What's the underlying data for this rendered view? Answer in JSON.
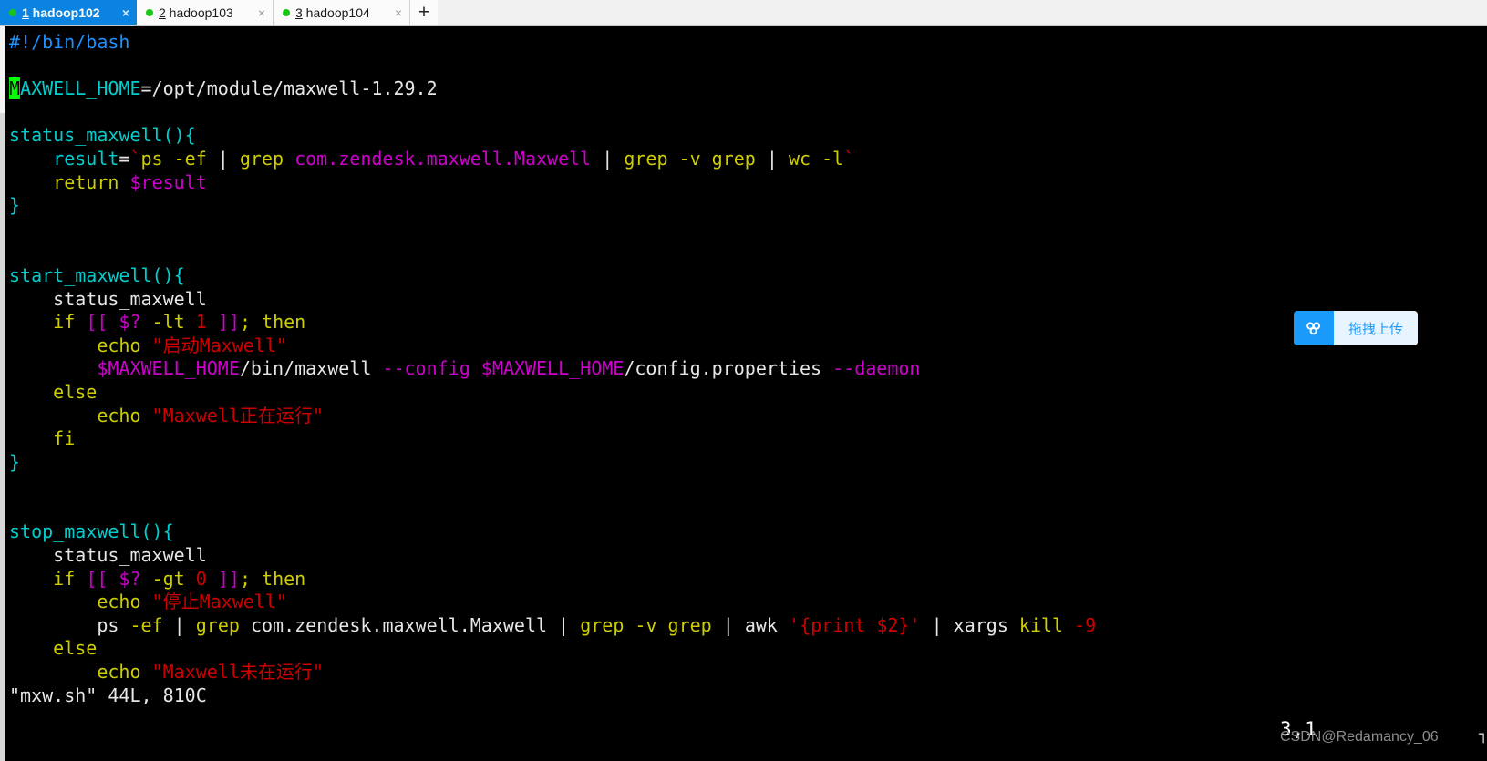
{
  "window": {
    "tabs": [
      {
        "index": "1",
        "name": " hadoop102",
        "active": true,
        "dot_color": "#17c617",
        "close": "×"
      },
      {
        "index": "2",
        "name": " hadoop103",
        "active": false,
        "dot_color": "#17c617",
        "close": "×"
      },
      {
        "index": "3",
        "name": " hadoop104",
        "active": false,
        "dot_color": "#17c617",
        "close": "×"
      }
    ],
    "new_tab_label": "+"
  },
  "editor": {
    "filename": "mxw.sh",
    "statusline": "\"mxw.sh\" 44L, 810C",
    "ruler": "3,1",
    "cursor_char": "M",
    "lines": [
      [
        {
          "t": "#!/bin/bash",
          "c": "c-comment"
        }
      ],
      [],
      [
        {
          "t": "M",
          "c": "cursor"
        },
        {
          "t": "AXWELL_HOME",
          "c": "c-ident"
        },
        {
          "t": "=/opt/module/maxwell-1.29.2",
          "c": "c-plain"
        }
      ],
      [],
      [
        {
          "t": "status_maxwell()",
          "c": "c-ident"
        },
        {
          "t": "{",
          "c": "c-ident"
        }
      ],
      [
        {
          "t": "    ",
          "c": "c-plain"
        },
        {
          "t": "result",
          "c": "c-ident"
        },
        {
          "t": "=",
          "c": "c-plain"
        },
        {
          "t": "`",
          "c": "c-str"
        },
        {
          "t": "ps -ef",
          "c": "c-stmt"
        },
        {
          "t": " | ",
          "c": "c-plain"
        },
        {
          "t": "grep",
          "c": "c-stmt"
        },
        {
          "t": " com.zendesk.maxwell.Maxwell",
          "c": "c-var"
        },
        {
          "t": " | ",
          "c": "c-plain"
        },
        {
          "t": "grep -v grep",
          "c": "c-stmt"
        },
        {
          "t": " | ",
          "c": "c-plain"
        },
        {
          "t": "wc -l",
          "c": "c-stmt"
        },
        {
          "t": "`",
          "c": "c-str"
        }
      ],
      [
        {
          "t": "    ",
          "c": "c-plain"
        },
        {
          "t": "return",
          "c": "c-stmt"
        },
        {
          "t": " ",
          "c": "c-plain"
        },
        {
          "t": "$result",
          "c": "c-var"
        }
      ],
      [
        {
          "t": "}",
          "c": "c-ident"
        }
      ],
      [],
      [],
      [
        {
          "t": "start_maxwell()",
          "c": "c-ident"
        },
        {
          "t": "{",
          "c": "c-ident"
        }
      ],
      [
        {
          "t": "    status_maxwell",
          "c": "c-plain"
        }
      ],
      [
        {
          "t": "    ",
          "c": "c-plain"
        },
        {
          "t": "if",
          "c": "c-stmt"
        },
        {
          "t": " ",
          "c": "c-plain"
        },
        {
          "t": "[[",
          "c": "c-var"
        },
        {
          "t": " ",
          "c": "c-plain"
        },
        {
          "t": "$?",
          "c": "c-var"
        },
        {
          "t": " ",
          "c": "c-plain"
        },
        {
          "t": "-lt",
          "c": "c-stmt"
        },
        {
          "t": " ",
          "c": "c-plain"
        },
        {
          "t": "1",
          "c": "c-num"
        },
        {
          "t": " ",
          "c": "c-plain"
        },
        {
          "t": "]]",
          "c": "c-var"
        },
        {
          "t": ";",
          "c": "c-stmt"
        },
        {
          "t": " ",
          "c": "c-plain"
        },
        {
          "t": "then",
          "c": "c-stmt"
        }
      ],
      [
        {
          "t": "        ",
          "c": "c-plain"
        },
        {
          "t": "echo",
          "c": "c-stmt"
        },
        {
          "t": " ",
          "c": "c-plain"
        },
        {
          "t": "\"启动Maxwell\"",
          "c": "c-str"
        }
      ],
      [
        {
          "t": "        ",
          "c": "c-plain"
        },
        {
          "t": "$MAXWELL_HOME",
          "c": "c-var"
        },
        {
          "t": "/bin/maxwell ",
          "c": "c-plain"
        },
        {
          "t": "--config",
          "c": "c-var"
        },
        {
          "t": " ",
          "c": "c-plain"
        },
        {
          "t": "$MAXWELL_HOME",
          "c": "c-var"
        },
        {
          "t": "/config.properties ",
          "c": "c-plain"
        },
        {
          "t": "--daemon",
          "c": "c-var"
        }
      ],
      [
        {
          "t": "    ",
          "c": "c-plain"
        },
        {
          "t": "else",
          "c": "c-stmt"
        }
      ],
      [
        {
          "t": "        ",
          "c": "c-plain"
        },
        {
          "t": "echo",
          "c": "c-stmt"
        },
        {
          "t": " ",
          "c": "c-plain"
        },
        {
          "t": "\"Maxwell正在运行\"",
          "c": "c-str"
        }
      ],
      [
        {
          "t": "    ",
          "c": "c-plain"
        },
        {
          "t": "fi",
          "c": "c-stmt"
        }
      ],
      [
        {
          "t": "}",
          "c": "c-ident"
        }
      ],
      [],
      [],
      [
        {
          "t": "stop_maxwell()",
          "c": "c-ident"
        },
        {
          "t": "{",
          "c": "c-ident"
        }
      ],
      [
        {
          "t": "    status_maxwell",
          "c": "c-plain"
        }
      ],
      [
        {
          "t": "    ",
          "c": "c-plain"
        },
        {
          "t": "if",
          "c": "c-stmt"
        },
        {
          "t": " ",
          "c": "c-plain"
        },
        {
          "t": "[[",
          "c": "c-var"
        },
        {
          "t": " ",
          "c": "c-plain"
        },
        {
          "t": "$?",
          "c": "c-var"
        },
        {
          "t": " ",
          "c": "c-plain"
        },
        {
          "t": "-gt",
          "c": "c-stmt"
        },
        {
          "t": " ",
          "c": "c-plain"
        },
        {
          "t": "0",
          "c": "c-num"
        },
        {
          "t": " ",
          "c": "c-plain"
        },
        {
          "t": "]]",
          "c": "c-var"
        },
        {
          "t": ";",
          "c": "c-stmt"
        },
        {
          "t": " ",
          "c": "c-plain"
        },
        {
          "t": "then",
          "c": "c-stmt"
        }
      ],
      [
        {
          "t": "        ",
          "c": "c-plain"
        },
        {
          "t": "echo",
          "c": "c-stmt"
        },
        {
          "t": " ",
          "c": "c-plain"
        },
        {
          "t": "\"停止Maxwell\"",
          "c": "c-str"
        }
      ],
      [
        {
          "t": "        ",
          "c": "c-plain"
        },
        {
          "t": "ps",
          "c": "c-plain"
        },
        {
          "t": " ",
          "c": "c-plain"
        },
        {
          "t": "-ef",
          "c": "c-stmt"
        },
        {
          "t": " ",
          "c": "c-plain"
        },
        {
          "t": "|",
          "c": "c-plain"
        },
        {
          "t": " ",
          "c": "c-plain"
        },
        {
          "t": "grep",
          "c": "c-stmt"
        },
        {
          "t": " com.zendesk.maxwell.Maxwell ",
          "c": "c-plain"
        },
        {
          "t": "|",
          "c": "c-plain"
        },
        {
          "t": " ",
          "c": "c-plain"
        },
        {
          "t": "grep -v grep",
          "c": "c-stmt"
        },
        {
          "t": " ",
          "c": "c-plain"
        },
        {
          "t": "|",
          "c": "c-plain"
        },
        {
          "t": " awk ",
          "c": "c-plain"
        },
        {
          "t": "'{print $2}'",
          "c": "c-str"
        },
        {
          "t": " ",
          "c": "c-plain"
        },
        {
          "t": "|",
          "c": "c-plain"
        },
        {
          "t": " xargs ",
          "c": "c-plain"
        },
        {
          "t": "kill",
          "c": "c-stmt"
        },
        {
          "t": " ",
          "c": "c-plain"
        },
        {
          "t": "-9",
          "c": "c-num"
        }
      ],
      [
        {
          "t": "    ",
          "c": "c-plain"
        },
        {
          "t": "else",
          "c": "c-stmt"
        }
      ],
      [
        {
          "t": "        ",
          "c": "c-plain"
        },
        {
          "t": "echo",
          "c": "c-stmt"
        },
        {
          "t": " ",
          "c": "c-plain"
        },
        {
          "t": "\"Maxwell未在运行\"",
          "c": "c-str"
        }
      ]
    ]
  },
  "upload_widget": {
    "label": "拖拽上传",
    "icon": "cloud-upload-icon",
    "accent": "#1a9bfc"
  },
  "watermark": {
    "text": "CSDN@Redamancy_06",
    "corner_glyph": "┐"
  }
}
